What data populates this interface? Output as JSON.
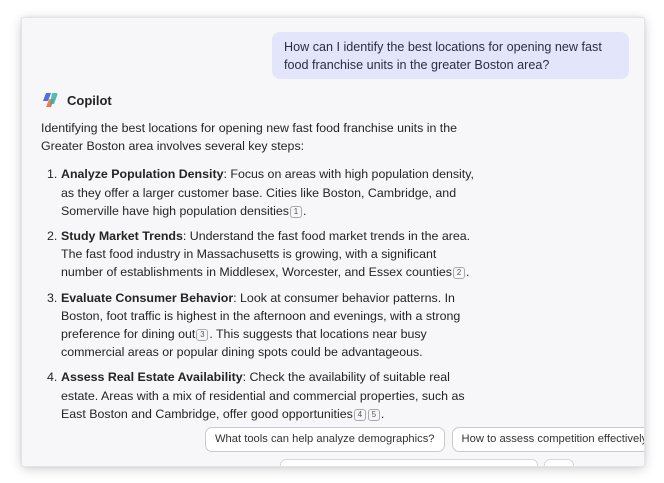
{
  "user_message": "How can I identify the best locations for opening new fast food franchise units in the greater Boston area?",
  "assistant": {
    "name": "Copilot",
    "intro": "Identifying the best locations for opening new fast food franchise units in the Greater Boston area involves several key steps:",
    "steps": [
      {
        "num": "1.",
        "title": "Analyze Population Density",
        "body": ": Focus on areas with high population density, as they offer a larger customer base. Cities like Boston, Cambridge, and Somerville have high population densities",
        "cites": [
          "1"
        ],
        "tail": "."
      },
      {
        "num": "2.",
        "title": "Study Market Trends",
        "body": ": Understand the fast food market trends in the area. The fast food industry in Massachusetts is growing, with a significant number of establishments in Middlesex, Worcester, and Essex counties",
        "cites": [
          "2"
        ],
        "tail": "."
      },
      {
        "num": "3.",
        "title": "Evaluate Consumer Behavior",
        "body": ": Look at consumer behavior patterns. In Boston, foot traffic is highest in the afternoon and evenings, with a strong preference for dining out",
        "cites": [
          "3"
        ],
        "tail": ". This suggests that locations near busy commercial areas or popular dining spots could be advantageous."
      },
      {
        "num": "4.",
        "title": "Assess Real Estate Availability",
        "body": ": Check the availability of suitable real estate. Areas with a mix of residential and commercial properties, such as East Boston and Cambridge, offer good opportunities",
        "cites": [
          "4",
          "5"
        ],
        "tail": "."
      }
    ]
  },
  "suggestions": [
    "What tools can help analyze demographics?",
    "How to assess competition effectively?"
  ],
  "colors": {
    "user_bubble": "#e3e6fb",
    "background": "#f7f7f9"
  }
}
